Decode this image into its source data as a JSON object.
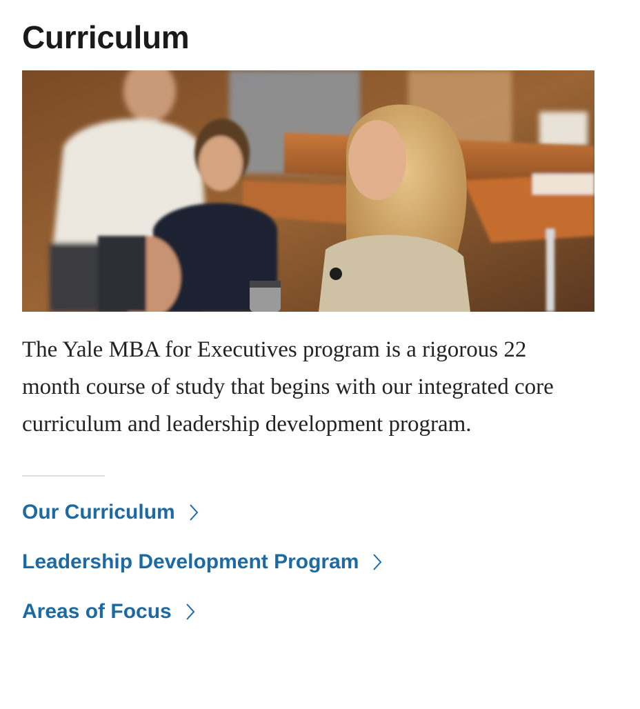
{
  "section": {
    "title": "Curriculum",
    "intro": "The Yale MBA for Executives program is a rigorous 22 month course of study that begins with our integrated core curriculum and leadership development program."
  },
  "links": [
    {
      "label": "Our Curriculum",
      "icon": "chevron-right-icon"
    },
    {
      "label": "Leadership Development Program",
      "icon": "chevron-right-icon"
    },
    {
      "label": "Areas of Focus",
      "icon": "chevron-right-icon"
    }
  ],
  "colors": {
    "heading": "#1a1a1a",
    "body_text": "#222222",
    "link": "#1c6aa3",
    "divider": "#dcdcdc"
  }
}
